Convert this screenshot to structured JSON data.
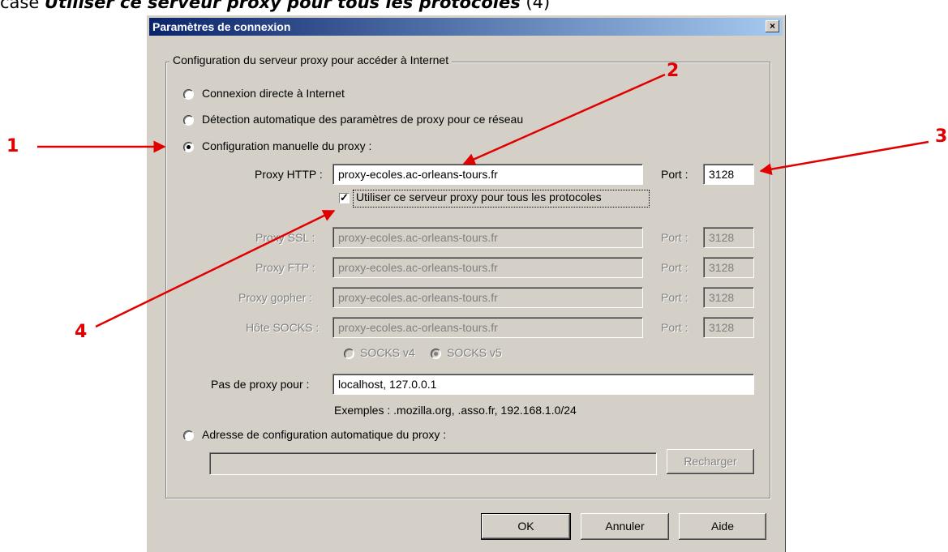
{
  "heading": {
    "prefix": "case ",
    "emphasis": "Utiliser ce serveur proxy pour tous les protocoles",
    "suffix": " (4)"
  },
  "dialog": {
    "title": "Paramètres de connexion",
    "close_label": "×",
    "group_title": "Configuration du serveur proxy pour accéder à Internet",
    "radio_direct": "Connexion directe à Internet",
    "radio_auto_detect": "Détection automatique des paramètres de proxy pour ce réseau",
    "radio_manual": "Configuration manuelle du proxy :",
    "http_label": "Proxy HTTP :",
    "http_value": "proxy-ecoles.ac-orleans-tours.fr",
    "port_label": "Port :",
    "http_port": "3128",
    "same_proxy_label": "Utiliser ce serveur proxy pour tous les protocoles",
    "same_proxy_checked": true,
    "ssl_label": "Proxy SSL :",
    "ssl_value": "proxy-ecoles.ac-orleans-tours.fr",
    "ssl_port": "3128",
    "ftp_label": "Proxy FTP :",
    "ftp_value": "proxy-ecoles.ac-orleans-tours.fr",
    "ftp_port": "3128",
    "gopher_label": "Proxy gopher :",
    "gopher_value": "proxy-ecoles.ac-orleans-tours.fr",
    "gopher_port": "3128",
    "socks_label": "Hôte SOCKS :",
    "socks_value": "proxy-ecoles.ac-orleans-tours.fr",
    "socks_port": "3128",
    "socks_v4": "SOCKS v4",
    "socks_v5": "SOCKS v5",
    "no_proxy_label": "Pas de proxy pour :",
    "no_proxy_value": "localhost, 127.0.0.1",
    "examples": "Exemples : .mozilla.org, .asso.fr, 192.168.1.0/24",
    "radio_auto_url": "Adresse de configuration automatique du proxy :",
    "auto_url_value": "",
    "reload_button": "Recharger",
    "ok_button": "OK",
    "cancel_button": "Annuler",
    "help_button": "Aide"
  },
  "annotations": {
    "a1": "1",
    "a2": "2",
    "a3": "3",
    "a4": "4",
    "color": "#e00000"
  }
}
